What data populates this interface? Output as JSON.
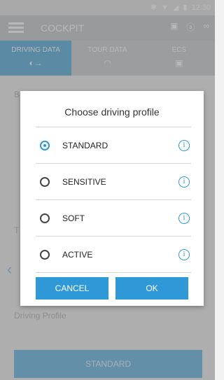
{
  "status_bar": {
    "time": "12:30"
  },
  "app_bar": {
    "title": "COCKPIT"
  },
  "tabs": [
    {
      "label": "DRIVING DATA",
      "active": true
    },
    {
      "label": "TOUR DATA",
      "active": false
    },
    {
      "label": "ECS",
      "active": false
    }
  ],
  "background": {
    "label_top": "B",
    "label_left": "T",
    "driving_profile_label": "Driving Profile",
    "profile_button": "STANDARD"
  },
  "dialog": {
    "title": "Choose driving profile",
    "options": [
      {
        "label": "STANDARD",
        "selected": true
      },
      {
        "label": "SENSITIVE",
        "selected": false
      },
      {
        "label": "SOFT",
        "selected": false
      },
      {
        "label": "ACTIVE",
        "selected": false
      }
    ],
    "cancel_label": "CANCEL",
    "ok_label": "OK"
  },
  "colors": {
    "accent": "#2f98d7",
    "tab_active": "#7fbfe5"
  }
}
